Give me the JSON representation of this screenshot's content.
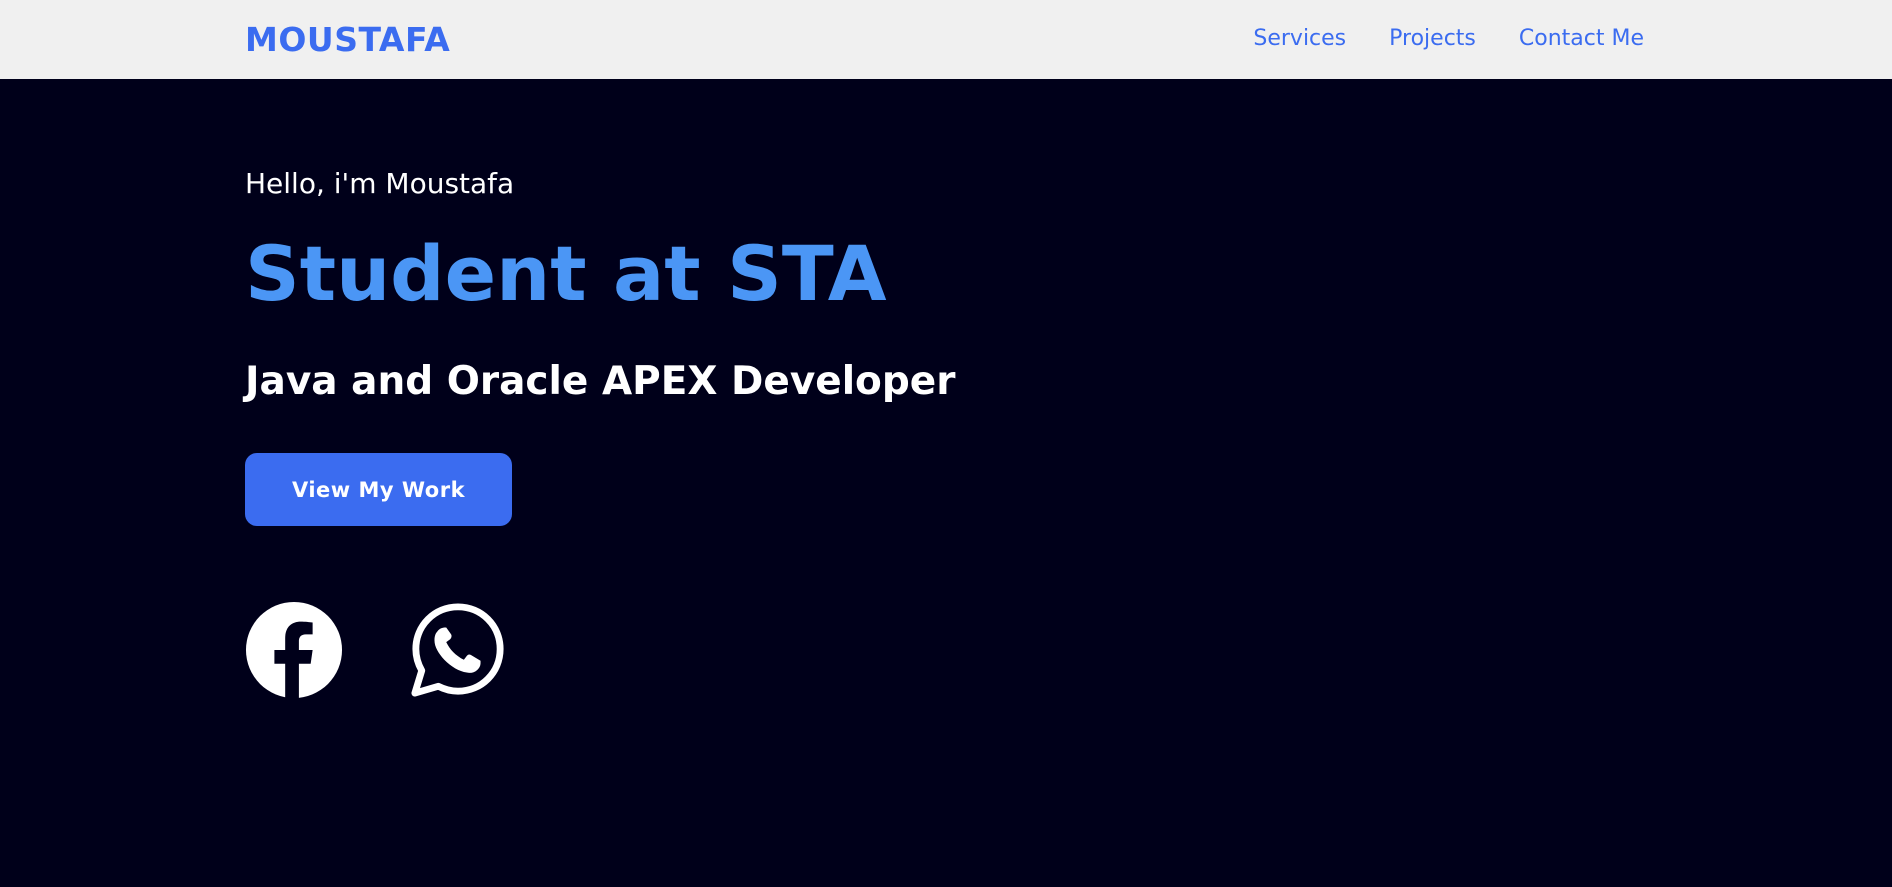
{
  "nav": {
    "logo": "MOUSTAFA",
    "links": [
      "Services",
      "Projects",
      "Contact Me"
    ]
  },
  "hero": {
    "greeting": "Hello, i'm Moustafa",
    "headline": "Student at STA",
    "subheadline": "Java and Oracle APEX Developer",
    "cta_label": "View My Work"
  },
  "social": {
    "icons": [
      "facebook-icon",
      "whatsapp-icon"
    ]
  },
  "colors": {
    "accent": "#3b6cf0",
    "headline": "#4b96f5",
    "background": "#00001a",
    "navbar": "#f0f0f0",
    "text": "#ffffff"
  }
}
